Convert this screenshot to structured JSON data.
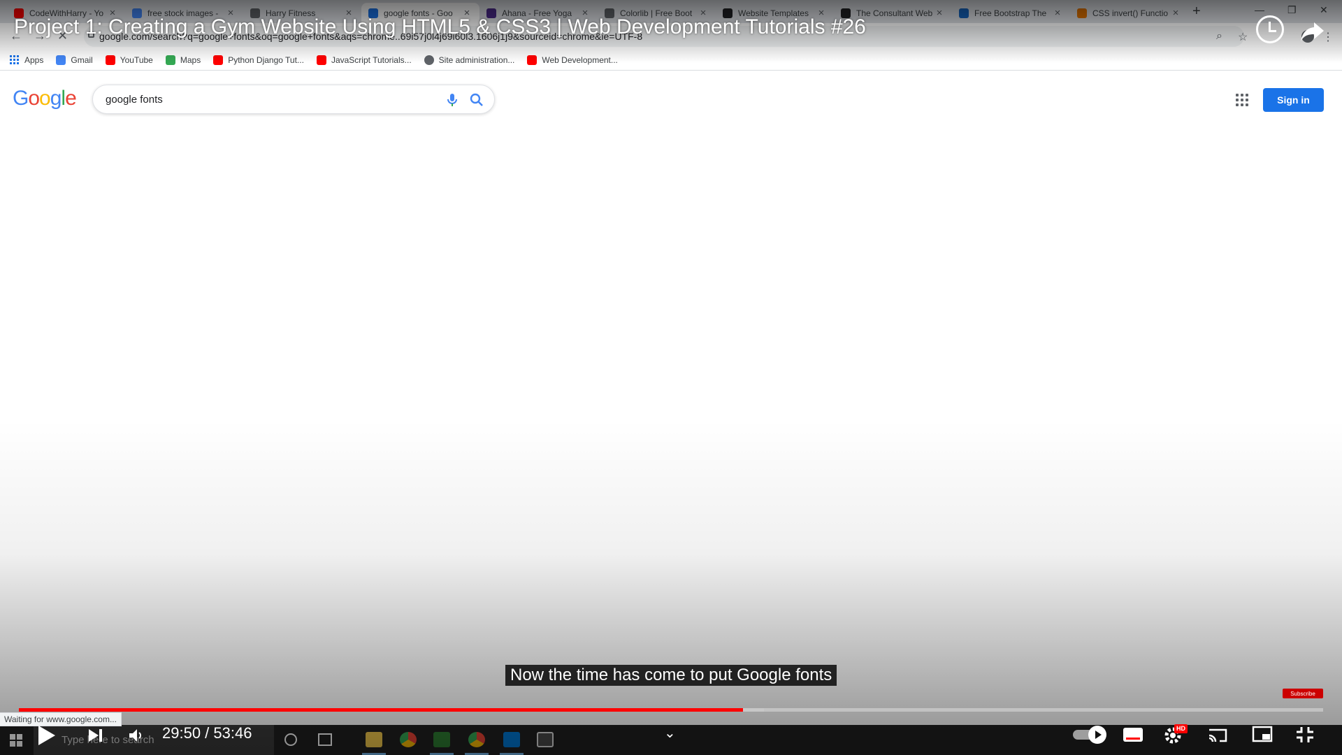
{
  "browser": {
    "tabs": [
      {
        "title": "CodeWithHarry - Yo",
        "icon": "youtube-icon",
        "color": "#ff0000"
      },
      {
        "title": "free stock images -",
        "icon": "google-g-icon",
        "color": "#4285f4"
      },
      {
        "title": "Harry Fitness",
        "icon": "globe-icon",
        "color": "#5f6368"
      },
      {
        "title": "google fonts - Goo",
        "icon": "loading-spinner-icon",
        "color": "#1a73e8",
        "active": true
      },
      {
        "title": "Ahana - Free Yoga",
        "icon": "site-icon",
        "color": "#4b2a8a"
      },
      {
        "title": "Colorlib | Free Boot",
        "icon": "wordpress-icon",
        "color": "#5f6368"
      },
      {
        "title": "Website Templates",
        "icon": "wix-icon",
        "color": "#202124"
      },
      {
        "title": "The Consultant Web",
        "icon": "wix-icon",
        "color": "#202124"
      },
      {
        "title": "Free Bootstrap The",
        "icon": "bootstrap-icon",
        "color": "#1565c0"
      },
      {
        "title": "CSS invert() Functio",
        "icon": "site-icon",
        "color": "#e37400"
      }
    ],
    "url": "google.com/search?q=google+fonts&oq=google+fonts&aqs=chrome..69i57j0l4j69i60l3.1606j1j9&sourceid=chrome&ie=UTF-8",
    "bookmarks": [
      {
        "label": "Apps",
        "icon": "apps-grid-icon"
      },
      {
        "label": "Gmail",
        "icon": "google-g-icon",
        "color": "#4285f4"
      },
      {
        "label": "YouTube",
        "icon": "youtube-icon",
        "color": "#ff0000"
      },
      {
        "label": "Maps",
        "icon": "maps-icon",
        "color": "#34a853"
      },
      {
        "label": "Python Django Tut...",
        "icon": "youtube-icon",
        "color": "#ff0000"
      },
      {
        "label": "JavaScript Tutorials...",
        "icon": "youtube-icon",
        "color": "#ff0000"
      },
      {
        "label": "Site administration...",
        "icon": "globe-icon",
        "color": "#5f6368"
      },
      {
        "label": "Web Development...",
        "icon": "youtube-icon",
        "color": "#ff0000"
      }
    ],
    "status_text": "Waiting for www.google.com..."
  },
  "google": {
    "logo": "Google",
    "logo_colors": [
      "#4285f4",
      "#ea4335",
      "#fbbc05",
      "#4285f4",
      "#34a853",
      "#ea4335"
    ],
    "query": "google fonts",
    "signin_label": "Sign in",
    "accent": "#1a73e8"
  },
  "player": {
    "video_title": "Project 1: Creating a Gym Website Using HTML5 & CSS3 | Web Development Tutorials #26",
    "caption": "Now the time has come to put Google fonts",
    "time_display": "29:50 / 53:46",
    "progress_fraction": 0.555,
    "buffered_fraction": 0.5715,
    "hd_badge": "HD",
    "subscribe_label": "Subscribe",
    "progress_color": "#ff0000"
  },
  "taskbar": {
    "search_placeholder": "Type here to search"
  }
}
